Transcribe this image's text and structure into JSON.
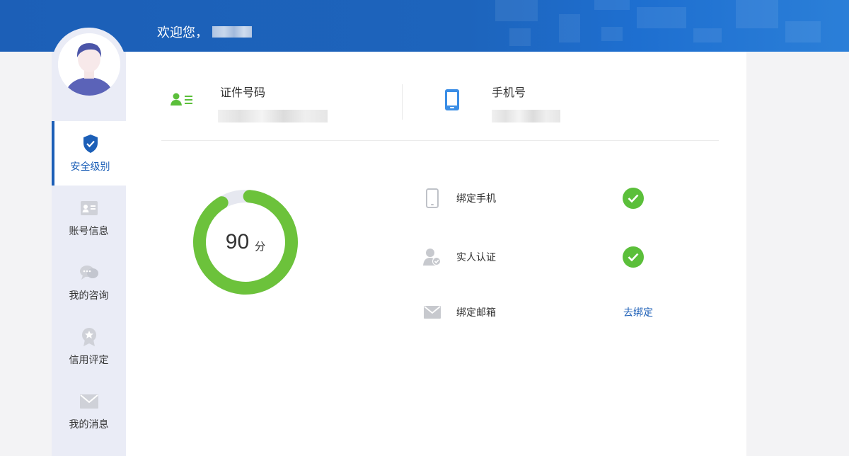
{
  "header": {
    "greeting": "欢迎您，"
  },
  "sidebar": {
    "items": [
      {
        "label": "安全级别",
        "icon": "shield-check-icon",
        "active": true
      },
      {
        "label": "账号信息",
        "icon": "id-card-icon",
        "active": false
      },
      {
        "label": "我的咨询",
        "icon": "chat-bubbles-icon",
        "active": false
      },
      {
        "label": "信用评定",
        "icon": "award-badge-icon",
        "active": false
      },
      {
        "label": "我的消息",
        "icon": "envelope-icon",
        "active": false
      }
    ]
  },
  "profile": {
    "id_label": "证件号码",
    "phone_label": "手机号"
  },
  "security": {
    "score": "90",
    "score_unit": "分",
    "score_fraction": 0.9,
    "items": [
      {
        "label": "绑定手机",
        "status": "done"
      },
      {
        "label": "实人认证",
        "status": "done"
      },
      {
        "label": "绑定邮箱",
        "status": "action",
        "action_label": "去绑定"
      }
    ]
  },
  "colors": {
    "brand": "#1c5fb7",
    "success": "#5bbf3a",
    "sidebar_bg": "#eaecf6"
  }
}
